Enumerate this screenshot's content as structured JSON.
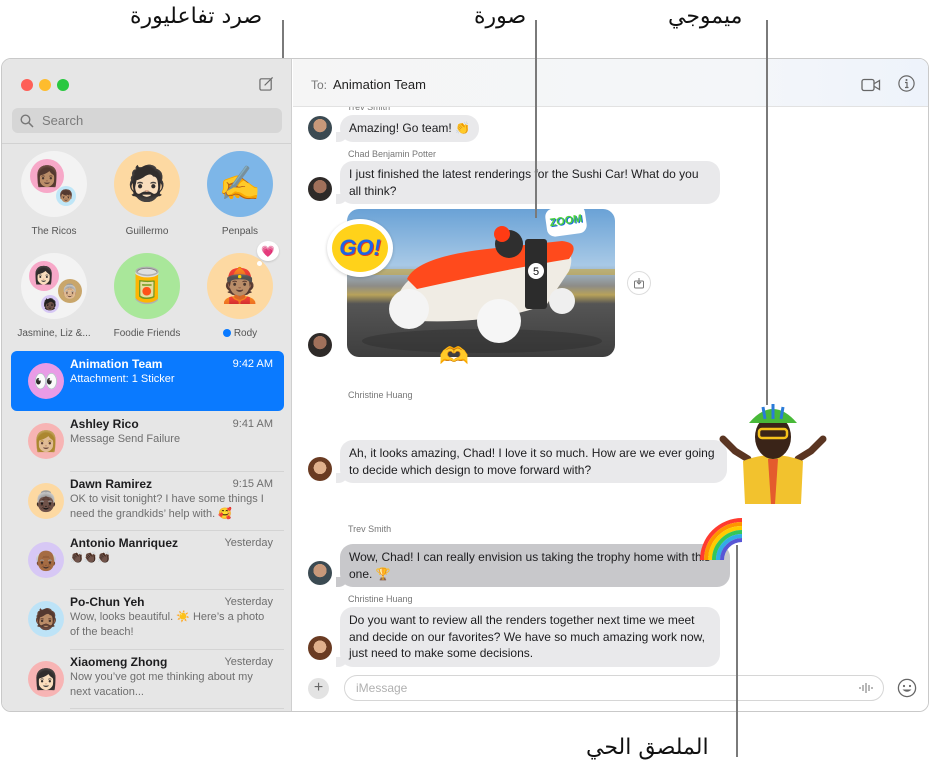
{
  "callouts": {
    "tapback": "صرد تفاعليورة",
    "photo": "صورة",
    "memoji": "ميموجي",
    "live_sticker": "الملصق الحي"
  },
  "window": {
    "traffic_lights": {
      "close": "#fe5f57",
      "minimize": "#febc2e",
      "zoom": "#28c840"
    },
    "compose_icon": "compose-icon"
  },
  "sidebar": {
    "search": {
      "placeholder": "Search",
      "value": ""
    },
    "pinned": [
      {
        "label": "The Ricos",
        "avatar": "group-memoji",
        "bg": "#f3f3f3"
      },
      {
        "label": "Guillermo",
        "avatar": "memoji-bearded-man",
        "bg": "#fdd9a2"
      },
      {
        "label": "Penpals",
        "avatar": "✍️",
        "bg": "#7db6e8"
      },
      {
        "label": "Jasmine, Liz &...",
        "avatar": "group-memoji",
        "bg": "#f3f3f3"
      },
      {
        "label": "Foodie Friends",
        "avatar": "🥫",
        "bg": "#a9e79a"
      },
      {
        "label": "Rody",
        "avatar": "memoji-green-beanie",
        "bg": "#fdd9a2",
        "unread": true,
        "tapback": "💗"
      }
    ],
    "conversations": [
      {
        "name": "Animation Team",
        "time": "9:42 AM",
        "preview": "Attachment: 1 Sticker",
        "avatar": "👀",
        "bg": "#e99be6",
        "selected": true
      },
      {
        "name": "Ashley Rico",
        "time": "9:41 AM",
        "preview": "Message Send Failure",
        "avatar": "memoji-woman-glasses",
        "bg": "#f7b4b4"
      },
      {
        "name": "Dawn Ramirez",
        "time": "9:15 AM",
        "preview": "OK to visit tonight? I have some things I need the grandkids’ help with. 🥰",
        "avatar": "memoji-grandma",
        "bg": "#fdd9a2"
      },
      {
        "name": "Antonio Manriquez",
        "time": "Yesterday",
        "preview": "👏🏿👏🏿👏🏿",
        "avatar": "memoji-grey-hair",
        "bg": "#d7c8f5"
      },
      {
        "name": "Po-Chun Yeh",
        "time": "Yesterday",
        "preview": "Wow, looks beautiful. ☀️ Here’s a photo of the beach!",
        "avatar": "memoji-beard",
        "bg": "#bde3f7"
      },
      {
        "name": "Xiaomeng Zhong",
        "time": "Yesterday",
        "preview": "Now you’ve got me thinking about my next vacation...",
        "avatar": "memoji-woman-dark-hair",
        "bg": "#f7b4b4"
      }
    ]
  },
  "chat": {
    "to_label": "To:",
    "to_value": "Animation Team",
    "messages": [
      {
        "sender": "Trev Smith",
        "text": "Amazing! Go team! 👏"
      },
      {
        "sender": "Chad Benjamin Potter",
        "text": "I just finished the latest renderings for the Sushi Car! What do you all think?"
      },
      {
        "sender": "",
        "attachment": "photo",
        "photo_caption": "Sushi race car rendering",
        "number": "5",
        "stickers": [
          "GO!",
          "ZOOM",
          "🫶"
        ]
      },
      {
        "sender": "Christine Huang",
        "text": "Ah, it looks amazing, Chad! I love it so much. How are we ever going to decide which design to move forward with?",
        "sticker": "memoji-shrug"
      },
      {
        "sender": "Trev Smith",
        "text": "Wow, Chad! I can really envision us taking the trophy home with this one. 🏆",
        "sticker": "🌈"
      },
      {
        "sender": "Christine Huang",
        "text": "Do you want to review all the renders together next time we meet and decide on our favorites? We have so much amazing work now, just need to make some decisions."
      }
    ],
    "input": {
      "placeholder": "iMessage",
      "value": ""
    }
  }
}
